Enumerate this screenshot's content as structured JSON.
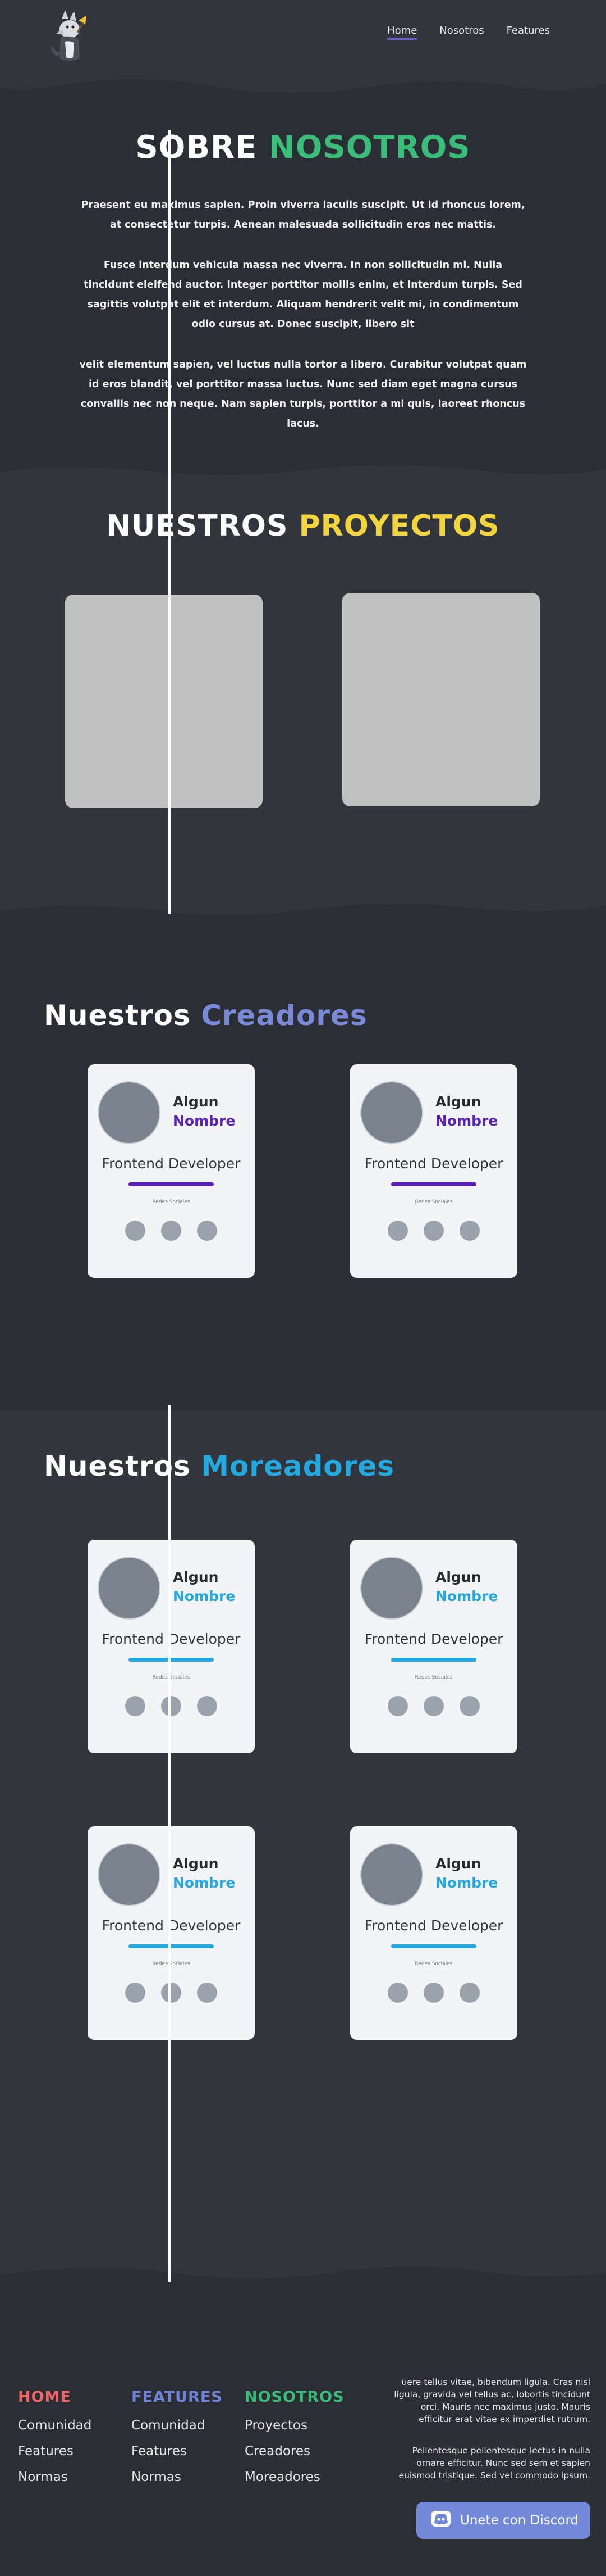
{
  "nav": {
    "items": [
      {
        "label": "Home",
        "active": true
      },
      {
        "label": "Nosotros",
        "active": false
      },
      {
        "label": "Features",
        "active": false
      }
    ]
  },
  "about": {
    "title_a": "SOBRE ",
    "title_b": "NOSOTROS",
    "paragraphs": [
      "Praesent eu maximus sapien. Proin viverra iaculis suscipit. Ut id rhoncus lorem, at consectetur turpis. Aenean malesuada sollicitudin eros nec mattis.",
      "Fusce interdum vehicula massa nec viverra. In non sollicitudin mi. Nulla tincidunt eleifend auctor. Integer porttitor mollis enim, et interdum turpis. Sed sagittis volutpat elit et interdum. Aliquam hendrerit velit mi, in condimentum odio cursus at. Donec suscipit, libero sit",
      "velit elementum sapien, vel luctus nulla tortor a libero. Curabitur volutpat quam id eros blandit, vel porttitor massa luctus. Nunc sed diam eget magna cursus convallis nec non neque. Nam sapien turpis, porttitor a mi quis, laoreet rhoncus lacus."
    ]
  },
  "projects": {
    "title_a": "NUESTROS ",
    "title_b": "PROYECTOS"
  },
  "creators": {
    "title_a": "Nuestros ",
    "title_b": "Creadores",
    "cards": [
      {
        "first": "Algun",
        "last": "Nombre",
        "role": "Frontend Developer",
        "social_label": "Redes Sociales"
      },
      {
        "first": "Algun",
        "last": "Nombre",
        "role": "Frontend Developer",
        "social_label": "Redes Sociales"
      }
    ]
  },
  "moderators": {
    "title_a": "Nuestros ",
    "title_b": "Moreadores",
    "cards": [
      {
        "first": "Algun",
        "last": "Nombre",
        "role": "Frontend Developer",
        "social_label": "Redes Sociales"
      },
      {
        "first": "Algun",
        "last": "Nombre",
        "role": "Frontend Developer",
        "social_label": "Redes Sociales"
      },
      {
        "first": "Algun",
        "last": "Nombre",
        "role": "Frontend Developer",
        "social_label": "Redes Sociales"
      },
      {
        "first": "Algun",
        "last": "Nombre",
        "role": "Frontend Developer",
        "social_label": "Redes Sociales"
      }
    ]
  },
  "footer": {
    "columns": [
      {
        "heading": "HOME",
        "links": [
          "Comunidad",
          "Features",
          "Normas"
        ]
      },
      {
        "heading": "FEATURES",
        "links": [
          "Comunidad",
          "Features",
          "Normas"
        ]
      },
      {
        "heading": "NOSOTROS",
        "links": [
          "Proyectos",
          "Creadores",
          "Moreadores"
        ]
      }
    ],
    "text_1": "uere tellus vitae, bibendum ligula. Cras nisl ligula, gravida vel tellus ac, lobortis tincidunt orci. Mauris nec maximus justo. Mauris efficitur erat vitae ex imperdiet rutrum.",
    "text_2": "Pellentesque pellentesque lectus in nulla ornare efficitur. Nunc sed sem et sapien euismod tristique. Sed vel commodo ipsum.",
    "discord_label": "Unete con Discord"
  },
  "colors": {
    "background": "#32353b",
    "green": "#3bbd7a",
    "yellow": "#f2d43d",
    "purple": "#5a21b6",
    "cyan": "#23a8e0",
    "discord": "#7289da"
  }
}
